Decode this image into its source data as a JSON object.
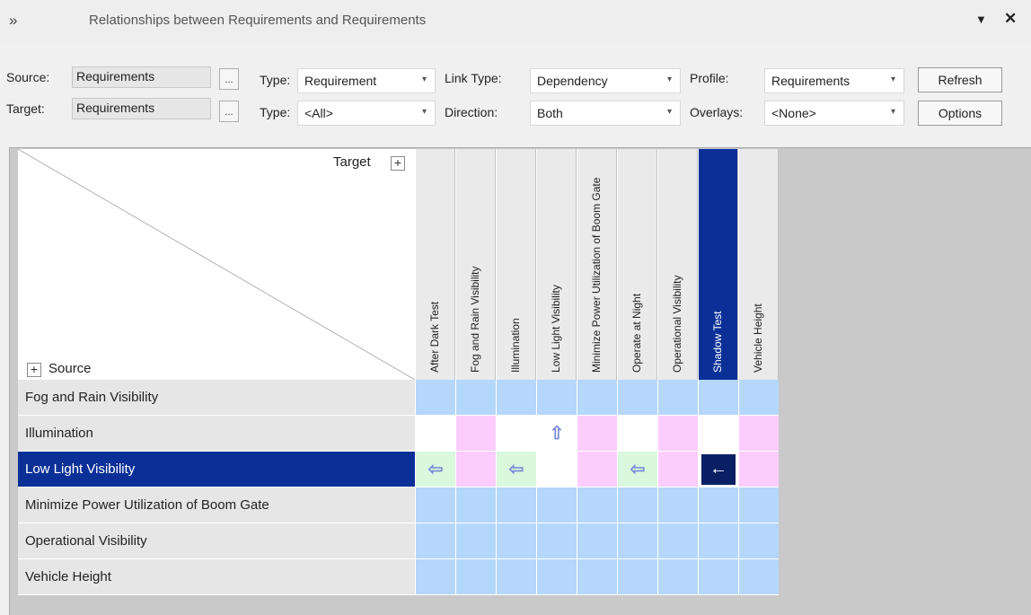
{
  "titlebar": {
    "chevron": "»",
    "title": "Relationships between Requirements and Requirements",
    "menu_icon": "▼",
    "close_icon": "✕"
  },
  "toolbar": {
    "source_label": "Source:",
    "source_value": "Requirements",
    "target_label": "Target:",
    "target_value": "Requirements",
    "ellipsis": "...",
    "type1_label": "Type:",
    "type1_value": "Requirement",
    "type2_label": "Type:",
    "type2_value": "<All>",
    "link_type_label": "Link Type:",
    "link_type_value": "Dependency",
    "direction_label": "Direction:",
    "direction_value": "Both",
    "profile_label": "Profile:",
    "profile_value": "Requirements",
    "overlays_label": "Overlays:",
    "overlays_value": "<None>",
    "refresh_label": "Refresh",
    "options_label": "Options",
    "dropdown_arrow": "▾"
  },
  "matrix": {
    "target_label": "Target",
    "source_label": "Source",
    "plus": "+",
    "columns": [
      "After Dark Test",
      "Fog and Rain Visibility",
      "Illumination",
      "Low Light Visibility",
      "Minimize Power Utilization of Boom Gate",
      "Operate at Night",
      "Operational Visibility",
      "Shadow Test",
      "Vehicle Height"
    ],
    "selected_column": 7,
    "rows": [
      "Fog and Rain Visibility",
      "Illumination",
      "Low Light Visibility",
      "Minimize Power Utilization of Boom Gate",
      "Operational Visibility",
      "Vehicle Height"
    ],
    "selected_row": 2,
    "cells": [
      [
        "blue",
        "blue",
        "blue",
        "blue",
        "blue",
        "blue",
        "blue",
        "blue",
        "blue"
      ],
      [
        "white",
        "pink",
        "white",
        "white:up",
        "pink",
        "white",
        "pink",
        "white",
        "pink"
      ],
      [
        "green:left",
        "pink",
        "green:left",
        "white",
        "pink",
        "green:left",
        "pink",
        "sel:left",
        "pink"
      ],
      [
        "blue",
        "blue",
        "blue",
        "blue",
        "blue",
        "blue",
        "blue",
        "blue",
        "blue"
      ],
      [
        "blue",
        "blue",
        "blue",
        "blue",
        "blue",
        "blue",
        "blue",
        "blue",
        "blue"
      ],
      [
        "blue",
        "blue",
        "blue",
        "blue",
        "blue",
        "blue",
        "blue",
        "blue",
        "blue"
      ]
    ],
    "arrow_up": "⇧",
    "arrow_left": "⇦",
    "arrow_left_bold": "←"
  },
  "colors": {
    "selection": "#0a3097",
    "link_cell": "#daf8de",
    "pink_cell": "#fccdfc",
    "blue_cell": "#b5d7fb"
  }
}
